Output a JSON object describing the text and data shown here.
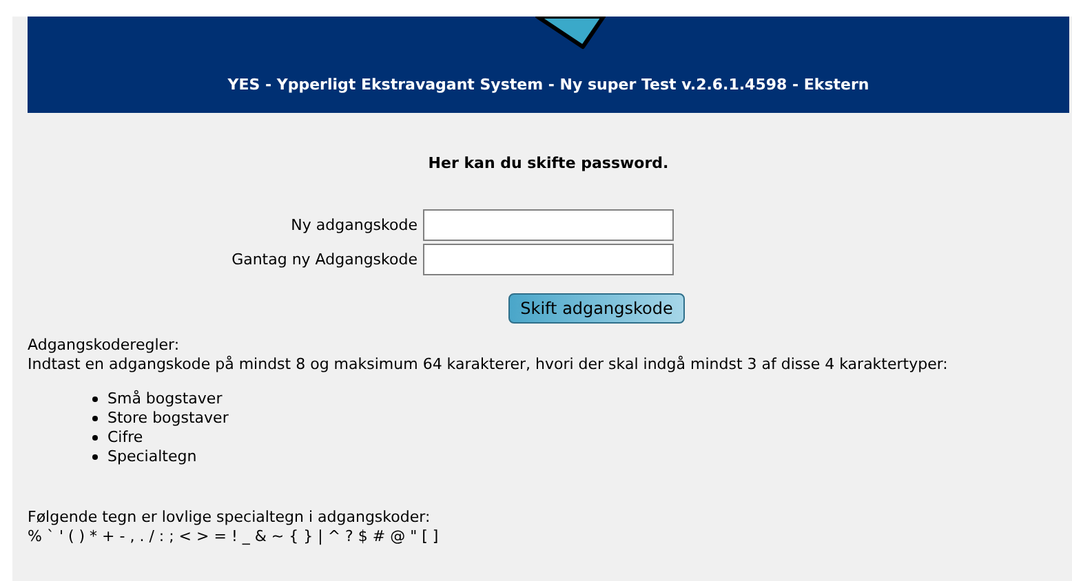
{
  "banner": {
    "title": "YES - Ypperligt Ekstravagant System - Ny super Test v.2.6.1.4598 - Ekstern"
  },
  "form": {
    "heading": "Her kan du skifte password.",
    "fields": [
      {
        "label": "Ny adgangskode"
      },
      {
        "label": "Gantag ny Adgangskode"
      }
    ],
    "submit": "Skift adgangskode"
  },
  "rules": {
    "title": "Adgangskoderegler:",
    "text": "Indtast en adgangskode på mindst 8 og maksimum 64 karakterer, hvori der skal indgå mindst 3 af disse 4 karaktertyper:",
    "items": [
      "Små bogstaver",
      "Store bogstaver",
      "Cifre",
      "Specialtegn"
    ]
  },
  "special": {
    "title": "Følgende tegn er lovlige specialtegn i adgangskoder:",
    "chars": "% ` ' ( ) * + - , . / : ; < > = ! _ & ~ { } | ^ ? $ # @ \" [ ]"
  }
}
